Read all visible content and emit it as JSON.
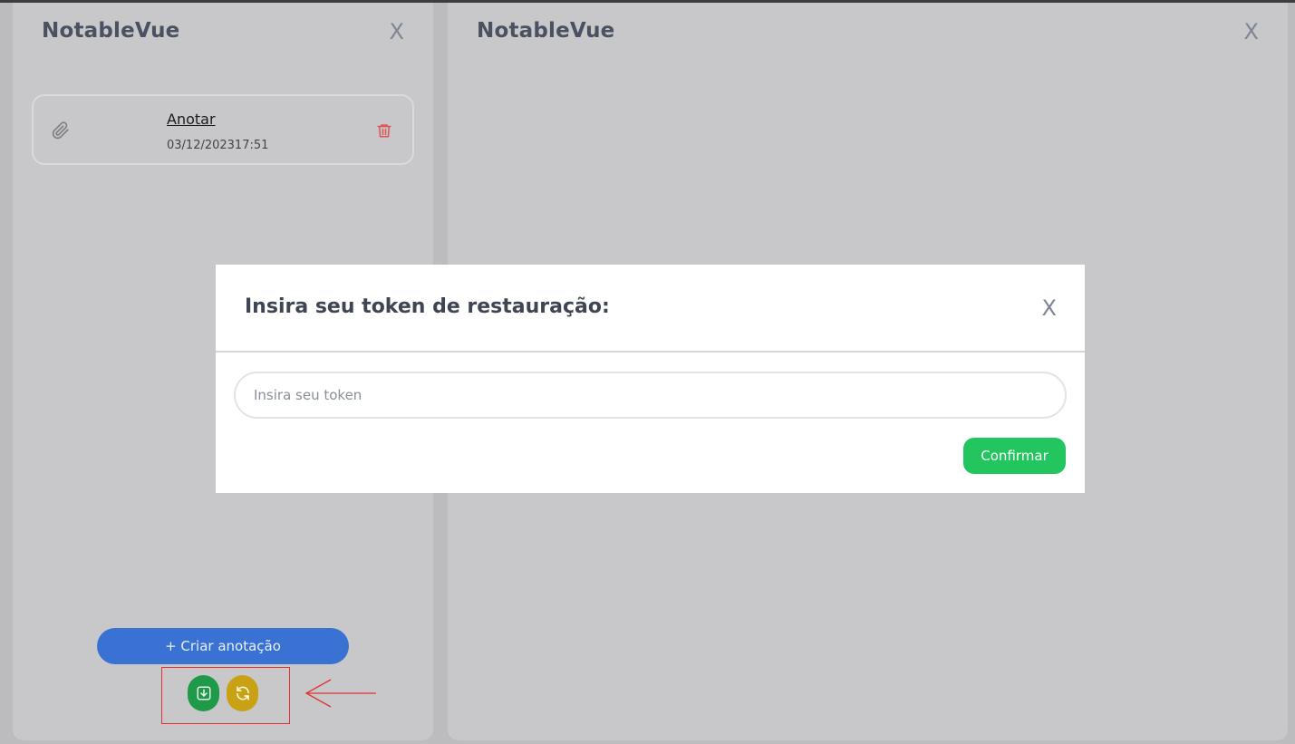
{
  "left_panel": {
    "title": "NotableVue",
    "close_label": "X",
    "notes": [
      {
        "title": "Anotar",
        "date": "03/12/202317:51"
      }
    ],
    "create_button_label": "+ Criar anotação",
    "export_icon": "download-icon",
    "restore_icon": "sync-icon"
  },
  "right_panel": {
    "title": "NotableVue",
    "close_label": "X"
  },
  "modal": {
    "title": "Insira seu token de restauração:",
    "close_label": "X",
    "input_placeholder": "Insira seu token",
    "input_value": "",
    "confirm_label": "Confirmar"
  },
  "colors": {
    "primary_blue": "#3a72d3",
    "green": "#22c55e",
    "export_green": "#1f9a48",
    "restore_yellow": "#c8a214",
    "trash_red": "#e05252",
    "annotation_red": "#e03131"
  }
}
